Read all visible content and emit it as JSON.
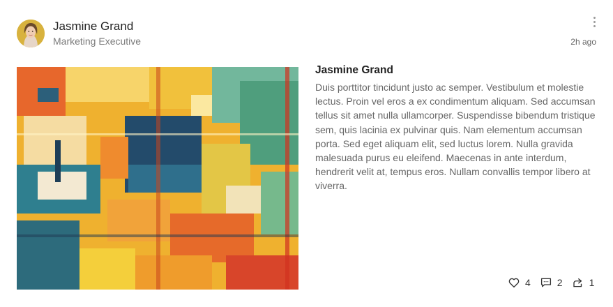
{
  "post": {
    "author": {
      "name": "Jasmine Grand",
      "role": "Marketing Executive"
    },
    "time": "2h ago",
    "title": "Jasmine Grand",
    "body": "Duis porttitor tincidunt justo ac semper. Vestibulum et molestie lectus. Proin vel eros a ex condimentum aliquam. Sed accumsan tellus sit amet nulla ullamcorper. Suspendisse bibendum tristique sem, quis lacinia ex pulvinar quis. Nam elementum accumsan porta. Sed eget aliquam elit, sed luctus lorem. Nulla gravida malesuada purus eu eleifend. Maecenas in ante interdum, hendrerit velit at, tempus eros. Nullam convallis tempor libero at viverra."
  },
  "reactions": {
    "likes": "4",
    "comments": "2",
    "shares": "1"
  },
  "icons": {
    "like": "heart-icon",
    "comment": "comment-icon",
    "share": "share-icon",
    "menu": "more-vertical-icon"
  },
  "colors": {
    "avatar_bg": "#d8b23e",
    "text_primary": "#222222",
    "text_secondary": "#666666"
  }
}
